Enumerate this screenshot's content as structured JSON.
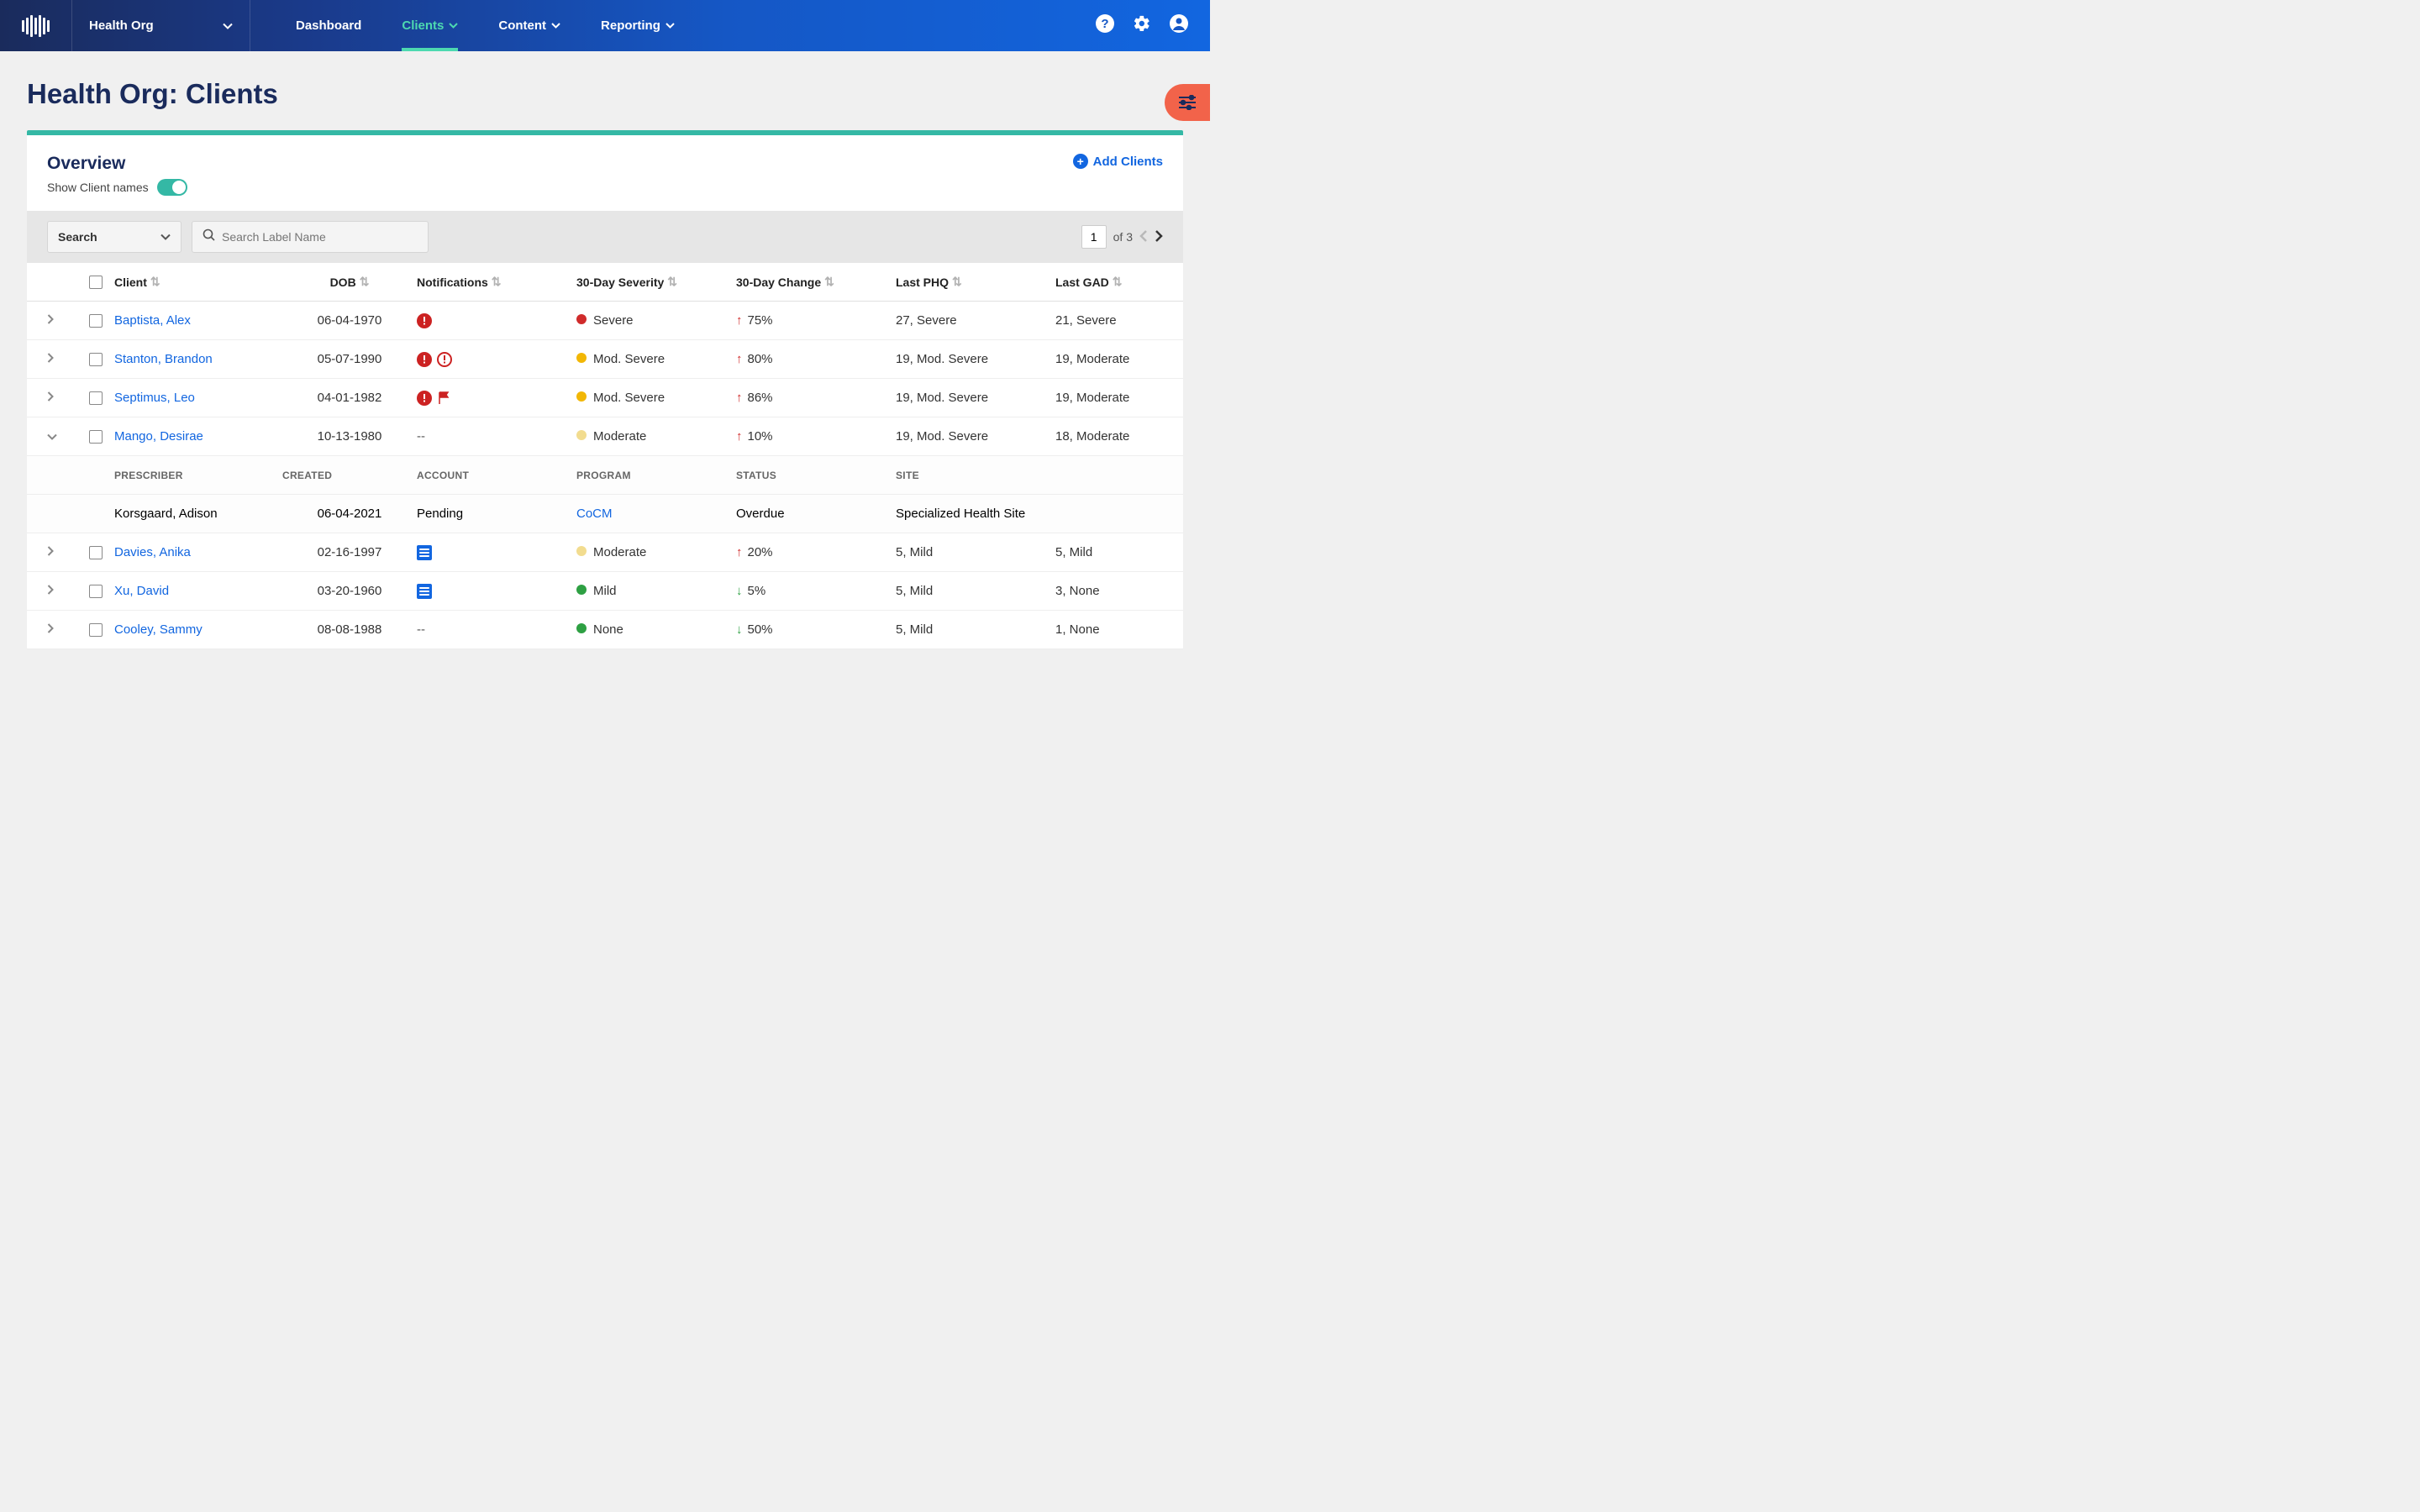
{
  "nav": {
    "org": "Health Org",
    "items": [
      {
        "label": "Dashboard",
        "dropdown": false
      },
      {
        "label": "Clients",
        "dropdown": true,
        "active": true
      },
      {
        "label": "Content",
        "dropdown": true
      },
      {
        "label": "Reporting",
        "dropdown": true
      }
    ]
  },
  "page": {
    "title": "Health Org: Clients"
  },
  "card": {
    "overview": "Overview",
    "toggle_label": "Show Client names",
    "add": "Add Clients"
  },
  "search": {
    "dropdown": "Search",
    "placeholder": "Search Label Name"
  },
  "pager": {
    "current": "1",
    "of_label": "of 3"
  },
  "columns": [
    "Client",
    "DOB",
    "Notifications",
    "30-Day Severity",
    "30-Day Change",
    "Last PHQ",
    "Last GAD"
  ],
  "rows": [
    {
      "name": "Baptista, Alex",
      "dob": "06-04-1970",
      "notif": [
        "alert-filled"
      ],
      "sev": {
        "dot": "red",
        "label": "Severe"
      },
      "chg": {
        "dir": "up",
        "val": "75%"
      },
      "phq": "27, Severe",
      "gad": "21, Severe",
      "expanded": false
    },
    {
      "name": "Stanton, Brandon",
      "dob": "05-07-1990",
      "notif": [
        "alert-filled",
        "alert-outline"
      ],
      "sev": {
        "dot": "orange",
        "label": "Mod. Severe"
      },
      "chg": {
        "dir": "up",
        "val": "80%"
      },
      "phq": "19, Mod. Severe",
      "gad": "19, Moderate",
      "expanded": false
    },
    {
      "name": "Septimus, Leo",
      "dob": "04-01-1982",
      "notif": [
        "alert-filled",
        "flag"
      ],
      "sev": {
        "dot": "orange",
        "label": "Mod. Severe"
      },
      "chg": {
        "dir": "up",
        "val": "86%"
      },
      "phq": "19, Mod. Severe",
      "gad": "19, Moderate",
      "expanded": false
    },
    {
      "name": "Mango, Desirae",
      "dob": "10-13-1980",
      "notif": [
        "dash"
      ],
      "sev": {
        "dot": "yellow",
        "label": "Moderate"
      },
      "chg": {
        "dir": "up",
        "val": "10%"
      },
      "phq": "19, Mod. Severe",
      "gad": "18, Moderate",
      "expanded": true,
      "detail": {
        "prescriber": "Korsgaard, Adison",
        "created": "06-04-2021",
        "account": "Pending",
        "program": "CoCM",
        "status": "Overdue",
        "site": "Specialized Health Site"
      }
    },
    {
      "name": "Davies, Anika",
      "dob": "02-16-1997",
      "notif": [
        "doc"
      ],
      "sev": {
        "dot": "yellow",
        "label": "Moderate"
      },
      "chg": {
        "dir": "up",
        "val": "20%"
      },
      "phq": "5, Mild",
      "gad": "5, Mild",
      "expanded": false
    },
    {
      "name": "Xu, David",
      "dob": "03-20-1960",
      "notif": [
        "doc"
      ],
      "sev": {
        "dot": "green",
        "label": "Mild"
      },
      "chg": {
        "dir": "down",
        "val": "5%"
      },
      "phq": "5, Mild",
      "gad": "3, None",
      "expanded": false
    },
    {
      "name": "Cooley, Sammy",
      "dob": "08-08-1988",
      "notif": [
        "dash"
      ],
      "sev": {
        "dot": "green",
        "label": "None"
      },
      "chg": {
        "dir": "down",
        "val": "50%"
      },
      "phq": "5, Mild",
      "gad": "1, None",
      "expanded": false
    }
  ],
  "detail_headers": [
    "PRESCRIBER",
    "CREATED",
    "ACCOUNT",
    "PROGRAM",
    "STATUS",
    "SITE"
  ]
}
